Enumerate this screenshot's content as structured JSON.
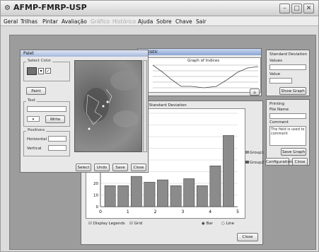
{
  "app": {
    "title": "AFMP-FMRP-USP"
  },
  "menu": [
    "Geral",
    "Trilhas",
    "Pintar",
    "Avaliação",
    "Gráfico",
    "Histórico",
    "Ajuda",
    "Sobre",
    "Chave",
    "Sair"
  ],
  "palette": {
    "title": "Palet",
    "select_color_label": "Select Color",
    "paint_label": "Paint",
    "text_label": "Text",
    "write_label": "Write",
    "position_label": "Positions",
    "horizontal_label": "Horizontal",
    "vertical_label": "Vertical",
    "buttons": [
      "Select",
      "Undo",
      "Save",
      "Close"
    ]
  },
  "graph_window": {
    "title": "Statistic",
    "top_chart_title": "Graph of Indices"
  },
  "std_dev_panel": {
    "title": "Standard Deviation",
    "values_label": "Values",
    "value_label": "Value",
    "show_graph_label": "Show Graph"
  },
  "file_panel": {
    "title": "Printing",
    "file_name_label": "File Name",
    "comment_label": "Comment",
    "comment_text": "The field is used to comment",
    "save_graph_label": "Save Graph",
    "configuration_label": "Configuration",
    "close_label": "Close"
  },
  "chart_window": {
    "title": "Graph of Standard Deviation",
    "legend": [
      "Group1",
      "Group2"
    ],
    "display_legends_label": "Display Legends",
    "grid_label": "Grid",
    "bar_label": "Bar",
    "line_label": "Line",
    "close_label": "Close"
  },
  "chart_data": {
    "type": "bar",
    "x_ticks": [
      0,
      1,
      2,
      3,
      4,
      5
    ],
    "y_ticks": [
      0,
      10,
      20
    ],
    "y_range": [
      0,
      80
    ],
    "series": [
      {
        "name": "Group1",
        "values": [
          18,
          18,
          26,
          21,
          23,
          18,
          24,
          18,
          35
        ]
      },
      {
        "name": "Group2",
        "values": [
          61
        ]
      }
    ]
  },
  "colors": {
    "titlebar": "#8aa6d3",
    "bar": "#8b8b8b",
    "workspace": "#9c9c9c"
  }
}
